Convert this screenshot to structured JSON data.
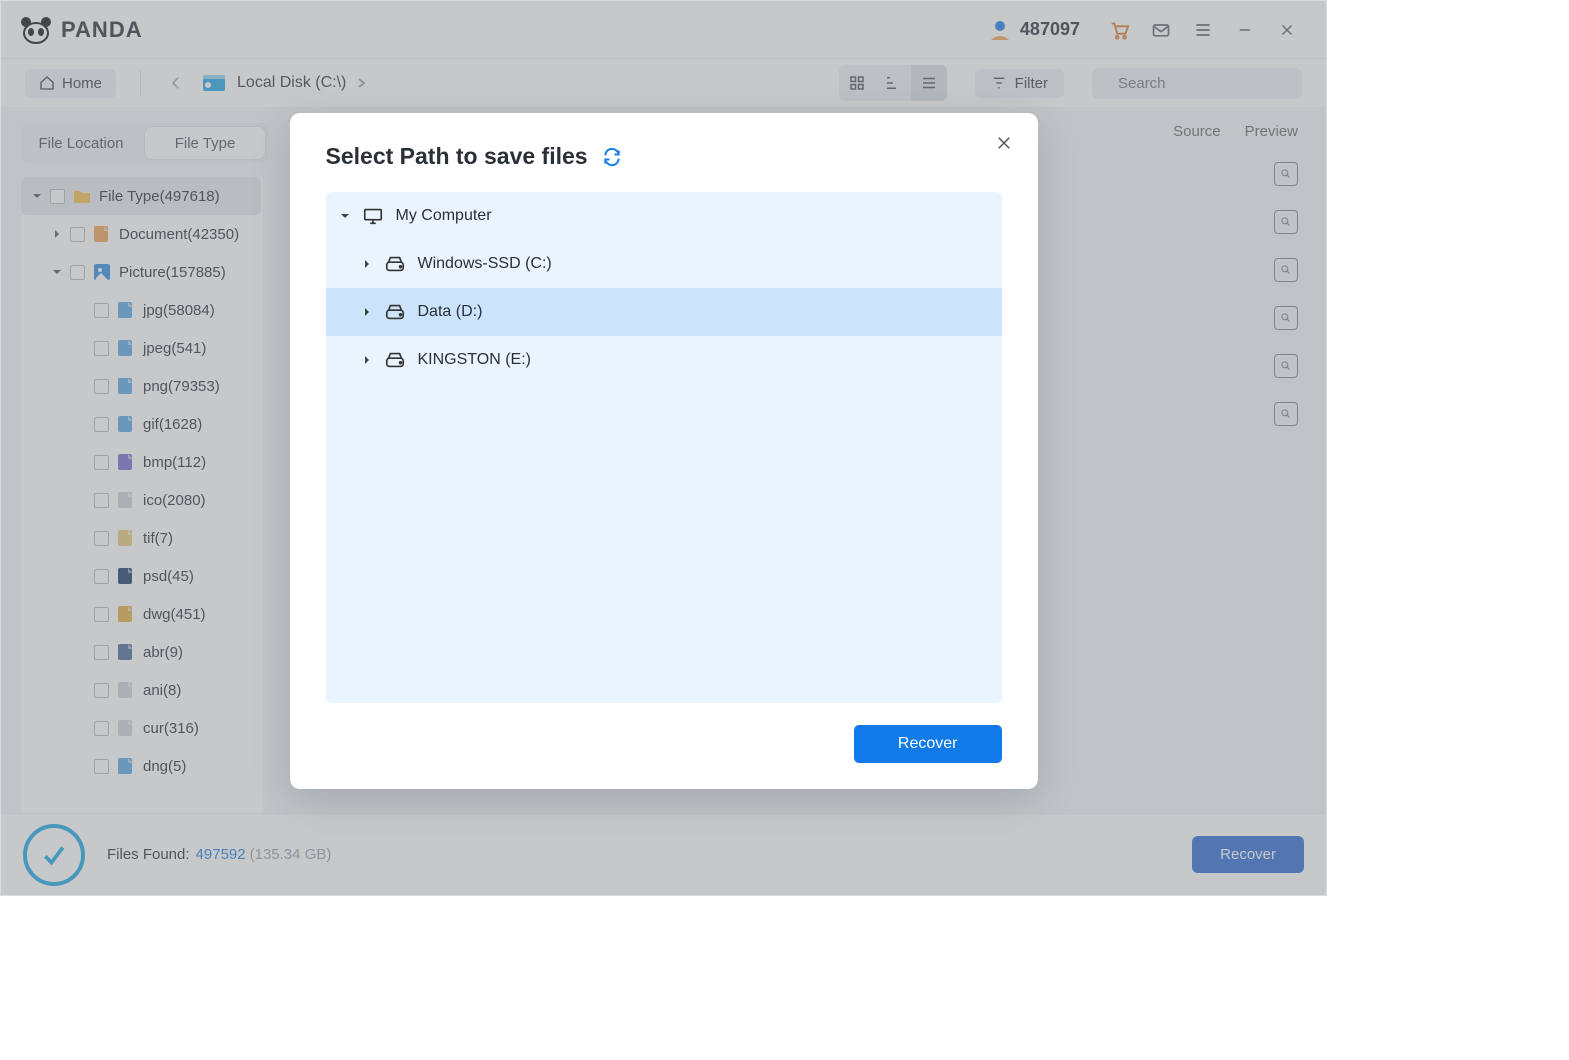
{
  "header": {
    "brand": "PANDA",
    "user_id": "487097"
  },
  "nav": {
    "home_label": "Home",
    "breadcrumb": "Local Disk (C:\\)",
    "filter_label": "Filter",
    "search_placeholder": "Search"
  },
  "sidebar": {
    "tab_location": "File Location",
    "tab_type": "File Type",
    "root_label": "File Type(497618)",
    "document_label": "Document(42350)",
    "picture_label": "Picture(157885)",
    "picture_children": [
      "jpg(58084)",
      "jpeg(541)",
      "png(79353)",
      "gif(1628)",
      "bmp(112)",
      "ico(2080)",
      "tif(7)",
      "psd(45)",
      "dwg(451)",
      "abr(9)",
      "ani(8)",
      "cur(316)",
      "dng(5)"
    ]
  },
  "rightpane": {
    "tab_source": "Source",
    "tab_preview": "Preview"
  },
  "footer": {
    "found_label": "Files Found:",
    "found_count": "497592",
    "found_size": "(135.34 GB)",
    "recover_label": "Recover"
  },
  "modal": {
    "title": "Select Path to save files",
    "root": "My Computer",
    "drives": [
      "Windows-SSD (C:)",
      "Data (D:)",
      "KINGSTON (E:)"
    ],
    "selected_index": 1,
    "recover_label": "Recover"
  }
}
